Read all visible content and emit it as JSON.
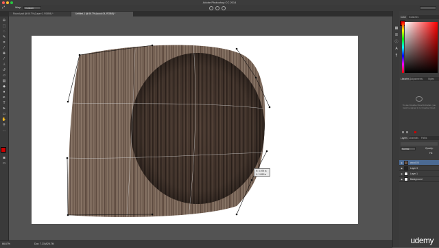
{
  "app": {
    "title": "Adobe Photoshop CC 2014"
  },
  "options_bar": {
    "warp_label": "Warp:",
    "warp_value": "Custom"
  },
  "document_tabs": [
    {
      "label": "Round.psd @ 66.7% (Layer 0, RGB/8) *",
      "active": false
    },
    {
      "label": "Untitled-1 @ 66.7% (wood-04, RGB/8) *",
      "active": true
    }
  ],
  "tooltip": {
    "line1": "H: 0.979 in",
    "line2": "V: 2.083 in"
  },
  "status": {
    "zoom": "66.67%",
    "doc": "Doc: 7.21M/25.7M"
  },
  "panels": {
    "color_tabs": [
      "Color",
      "Swatches"
    ],
    "libraries_tabs": [
      "Libraries",
      "Adjustments",
      "Styles"
    ],
    "libraries_message": "To use Creative Cloud Libraries, you must be signed in to Creative Cloud.",
    "layers_tabs": [
      "Layers",
      "Channels",
      "Paths"
    ],
    "blend_mode": "Normal",
    "opacity_label": "Opacity:",
    "fill_label": "Fill:",
    "layers": [
      {
        "name": "wood-04",
        "selected": true
      },
      {
        "name": "Layer 3",
        "selected": false
      },
      {
        "name": "Layer 1",
        "selected": false
      },
      {
        "name": "Background",
        "selected": false
      }
    ]
  },
  "colors": {
    "foreground": "#d00000",
    "background": "#ffffff",
    "accent_red": "#cc0000",
    "selected_layer": "#4b6a93"
  },
  "watermark": {
    "text": "udemy"
  }
}
